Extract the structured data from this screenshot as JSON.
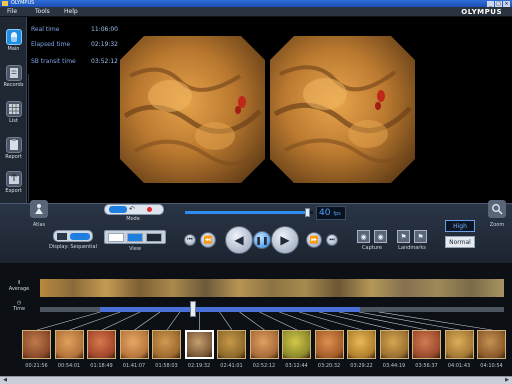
{
  "window": {
    "title": "OLYMPUS",
    "btn_min": "_",
    "btn_max": "□",
    "btn_close": "×"
  },
  "menu": {
    "file": "File",
    "tools": "Tools",
    "help": "Help",
    "brand": "OLYMPUS"
  },
  "toolbar": {
    "items": [
      {
        "label": "Main",
        "icon": "capsule-icon",
        "active": true
      },
      {
        "label": "Records",
        "icon": "records-icon",
        "active": false
      },
      {
        "label": "List",
        "icon": "list-icon",
        "active": false
      },
      {
        "label": "Report",
        "icon": "report-icon",
        "active": false
      },
      {
        "label": "Export",
        "icon": "export-icon",
        "active": false
      }
    ]
  },
  "info": {
    "rows": [
      {
        "label": "Real time",
        "value": "11:06:00"
      },
      {
        "label": "Elapsed time",
        "value": "02:19:32"
      },
      {
        "label": "SB transit time",
        "value": "03:52:12"
      }
    ]
  },
  "controls": {
    "atlas_label": "Atlas",
    "mode_label": "Mode",
    "display_label": "Display: Sequential",
    "view_label": "View",
    "speed_value": "40",
    "speed_unit": "fps",
    "speed_fraction": 0.98,
    "capture_label": "Capture",
    "landmarks_label": "Landmarks",
    "high_label": "High",
    "normal_label": "Normal",
    "zoom_label": "Zoom",
    "play_icons": [
      "first-icon",
      "prev-icon",
      "rewind-icon",
      "pause-icon",
      "play-icon",
      "next-icon",
      "last-icon"
    ]
  },
  "strips": {
    "average_label": "Average",
    "time_label": "Time",
    "time_range_start": 0.13,
    "time_range_end": 0.69,
    "time_position": 0.33
  },
  "thumbnails": {
    "selected_index": 5,
    "items": [
      {
        "time": "00:21:56"
      },
      {
        "time": "00:54:01"
      },
      {
        "time": "01:18:49"
      },
      {
        "time": "01:41:07"
      },
      {
        "time": "01:58:03"
      },
      {
        "time": "02:19:32"
      },
      {
        "time": "02:41:01"
      },
      {
        "time": "02:52:12"
      },
      {
        "time": "03:12:44"
      },
      {
        "time": "03:20:32"
      },
      {
        "time": "03:29:22"
      },
      {
        "time": "03:44:19"
      },
      {
        "time": "03:56:37"
      },
      {
        "time": "04:01:43"
      },
      {
        "time": "04:10:54"
      }
    ]
  }
}
